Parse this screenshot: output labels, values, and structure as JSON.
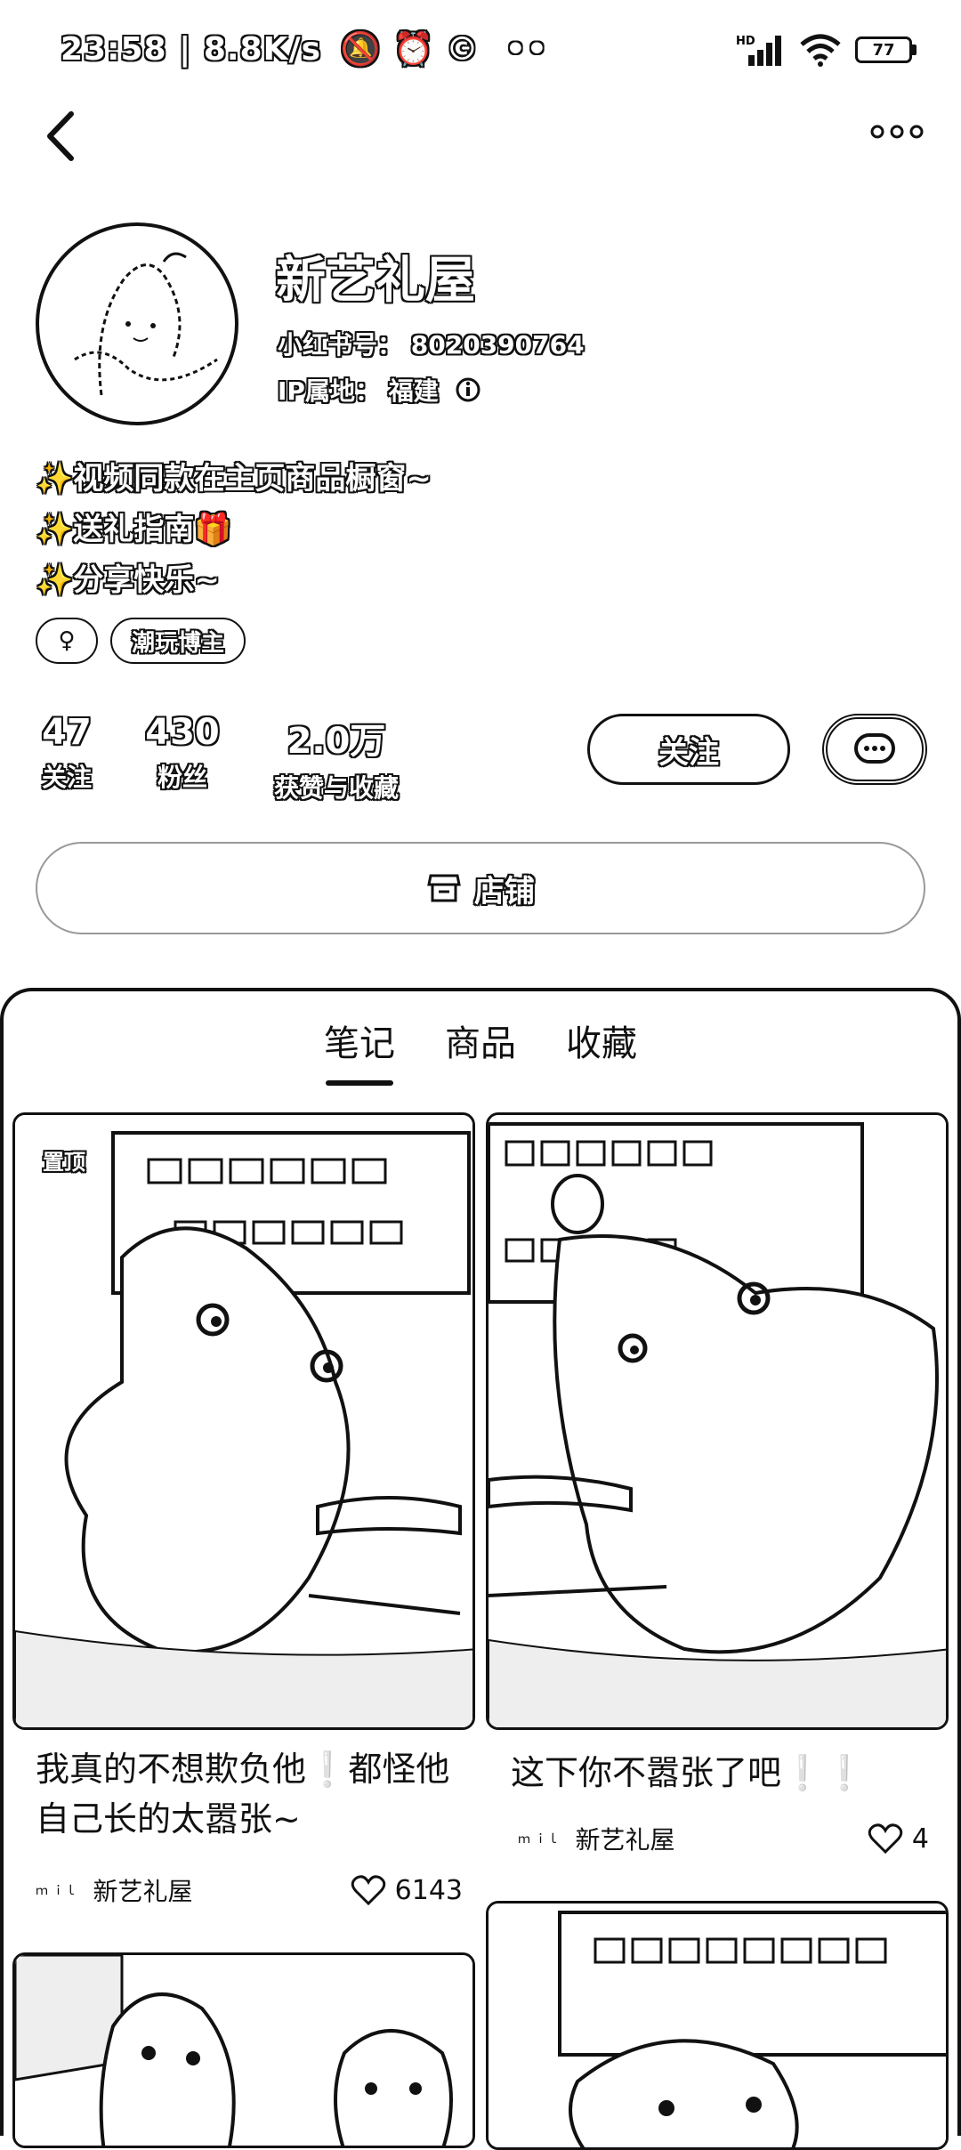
{
  "status_bar": {
    "time": "23:58",
    "speed": "8.8K/s",
    "extra": "••",
    "battery": "77"
  },
  "profile": {
    "name": "新艺礼屋",
    "id_label": "小红书号：",
    "id_value": "8020390764",
    "ip_label": "IP属地：",
    "ip_value": "福建",
    "bio": [
      "✨视频同款在主页商品橱窗~",
      "✨送礼指南🎁",
      "✨分享快乐~"
    ],
    "tags": [
      "♀",
      "潮玩博主"
    ]
  },
  "stats": [
    {
      "value": "47",
      "label": "关注"
    },
    {
      "value": "430",
      "label": "粉丝"
    },
    {
      "value": "2.0万",
      "label": "获赞与收藏"
    }
  ],
  "actions": {
    "follow": "关注",
    "shop": "店铺"
  },
  "tabs": [
    "笔记",
    "商品",
    "收藏"
  ],
  "active_tab": "笔记",
  "notes": [
    {
      "pinned": "置顶",
      "title": "我真的不想欺负他❕都怪他自己长的太嚣张~",
      "author": "新艺礼屋",
      "likes": "6143"
    },
    {
      "title": "这下你不嚣张了吧❕❕",
      "author": "新艺礼屋",
      "likes": "4"
    }
  ],
  "icons": [
    "back-icon",
    "more-icon",
    "info-icon",
    "chat-icon",
    "store-icon",
    "heart-icon",
    "avatar-icon"
  ]
}
